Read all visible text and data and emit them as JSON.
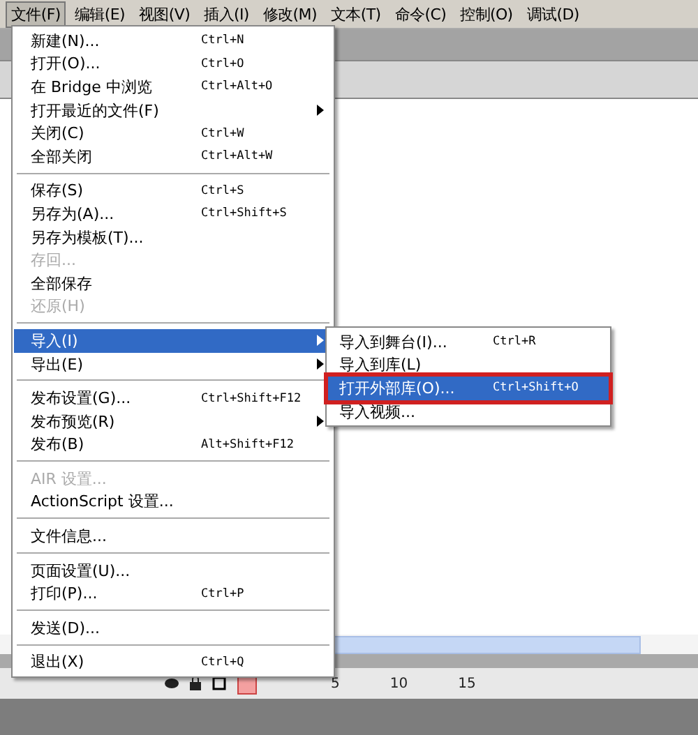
{
  "menubar": [
    {
      "label": "文件(F)",
      "selected": true
    },
    {
      "label": "编辑(E)",
      "selected": false
    },
    {
      "label": "视图(V)",
      "selected": false
    },
    {
      "label": "插入(I)",
      "selected": false
    },
    {
      "label": "修改(M)",
      "selected": false
    },
    {
      "label": "文本(T)",
      "selected": false
    },
    {
      "label": "命令(C)",
      "selected": false
    },
    {
      "label": "控制(O)",
      "selected": false
    },
    {
      "label": "调试(D)",
      "selected": false
    }
  ],
  "file_menu": [
    {
      "kind": "item",
      "label": "新建(N)...",
      "shortcut": "Ctrl+N",
      "disabled": false,
      "selected": false,
      "submenu": false
    },
    {
      "kind": "item",
      "label": "打开(O)...",
      "shortcut": "Ctrl+O",
      "disabled": false,
      "selected": false,
      "submenu": false
    },
    {
      "kind": "item",
      "label": "在 Bridge 中浏览",
      "shortcut": "Ctrl+Alt+O",
      "disabled": false,
      "selected": false,
      "submenu": false
    },
    {
      "kind": "item",
      "label": "打开最近的文件(F)",
      "disabled": false,
      "selected": false,
      "submenu": true
    },
    {
      "kind": "item",
      "label": "关闭(C)",
      "shortcut": "Ctrl+W",
      "disabled": false,
      "selected": false,
      "submenu": false
    },
    {
      "kind": "item",
      "label": "全部关闭",
      "shortcut": "Ctrl+Alt+W",
      "disabled": false,
      "selected": false,
      "submenu": false
    },
    {
      "kind": "separator"
    },
    {
      "kind": "item",
      "label": "保存(S)",
      "shortcut": "Ctrl+S",
      "disabled": false,
      "selected": false,
      "submenu": false
    },
    {
      "kind": "item",
      "label": "另存为(A)...",
      "shortcut": "Ctrl+Shift+S",
      "disabled": false,
      "selected": false,
      "submenu": false
    },
    {
      "kind": "item",
      "label": "另存为模板(T)...",
      "disabled": false,
      "selected": false,
      "submenu": false
    },
    {
      "kind": "item",
      "label": "存回...",
      "disabled": true,
      "selected": false,
      "submenu": false
    },
    {
      "kind": "item",
      "label": "全部保存",
      "disabled": false,
      "selected": false,
      "submenu": false
    },
    {
      "kind": "item",
      "label": "还原(H)",
      "disabled": true,
      "selected": false,
      "submenu": false
    },
    {
      "kind": "separator"
    },
    {
      "kind": "item",
      "label": "导入(I)",
      "disabled": false,
      "selected": true,
      "submenu": true
    },
    {
      "kind": "item",
      "label": "导出(E)",
      "disabled": false,
      "selected": false,
      "submenu": true
    },
    {
      "kind": "separator"
    },
    {
      "kind": "item",
      "label": "发布设置(G)...",
      "shortcut": "Ctrl+Shift+F12",
      "disabled": false,
      "selected": false,
      "submenu": false
    },
    {
      "kind": "item",
      "label": "发布预览(R)",
      "disabled": false,
      "selected": false,
      "submenu": true
    },
    {
      "kind": "item",
      "label": "发布(B)",
      "shortcut": "Alt+Shift+F12",
      "disabled": false,
      "selected": false,
      "submenu": false
    },
    {
      "kind": "separator"
    },
    {
      "kind": "item",
      "label": "AIR 设置...",
      "disabled": true,
      "selected": false,
      "submenu": false
    },
    {
      "kind": "item",
      "label": "ActionScript 设置...",
      "disabled": false,
      "selected": false,
      "submenu": false
    },
    {
      "kind": "separator"
    },
    {
      "kind": "item",
      "label": "文件信息...",
      "disabled": false,
      "selected": false,
      "submenu": false
    },
    {
      "kind": "separator"
    },
    {
      "kind": "item",
      "label": "页面设置(U)...",
      "disabled": false,
      "selected": false,
      "submenu": false
    },
    {
      "kind": "item",
      "label": "打印(P)...",
      "shortcut": "Ctrl+P",
      "disabled": false,
      "selected": false,
      "submenu": false
    },
    {
      "kind": "separator"
    },
    {
      "kind": "item",
      "label": "发送(D)...",
      "disabled": false,
      "selected": false,
      "submenu": false
    },
    {
      "kind": "separator"
    },
    {
      "kind": "item",
      "label": "退出(X)",
      "shortcut": "Ctrl+Q",
      "disabled": false,
      "selected": false,
      "submenu": false
    }
  ],
  "import_submenu": [
    {
      "label": "导入到舞台(I)...",
      "shortcut": "Ctrl+R",
      "selected": false,
      "outlined": false
    },
    {
      "label": "导入到库(L)",
      "selected": false,
      "outlined": false
    },
    {
      "label": "打开外部库(O)...",
      "shortcut": "Ctrl+Shift+O",
      "selected": true,
      "outlined": true
    },
    {
      "label": "导入视频...",
      "selected": false,
      "outlined": false
    }
  ],
  "timeline": {
    "frame_numbers": [
      "5",
      "10",
      "15"
    ]
  }
}
